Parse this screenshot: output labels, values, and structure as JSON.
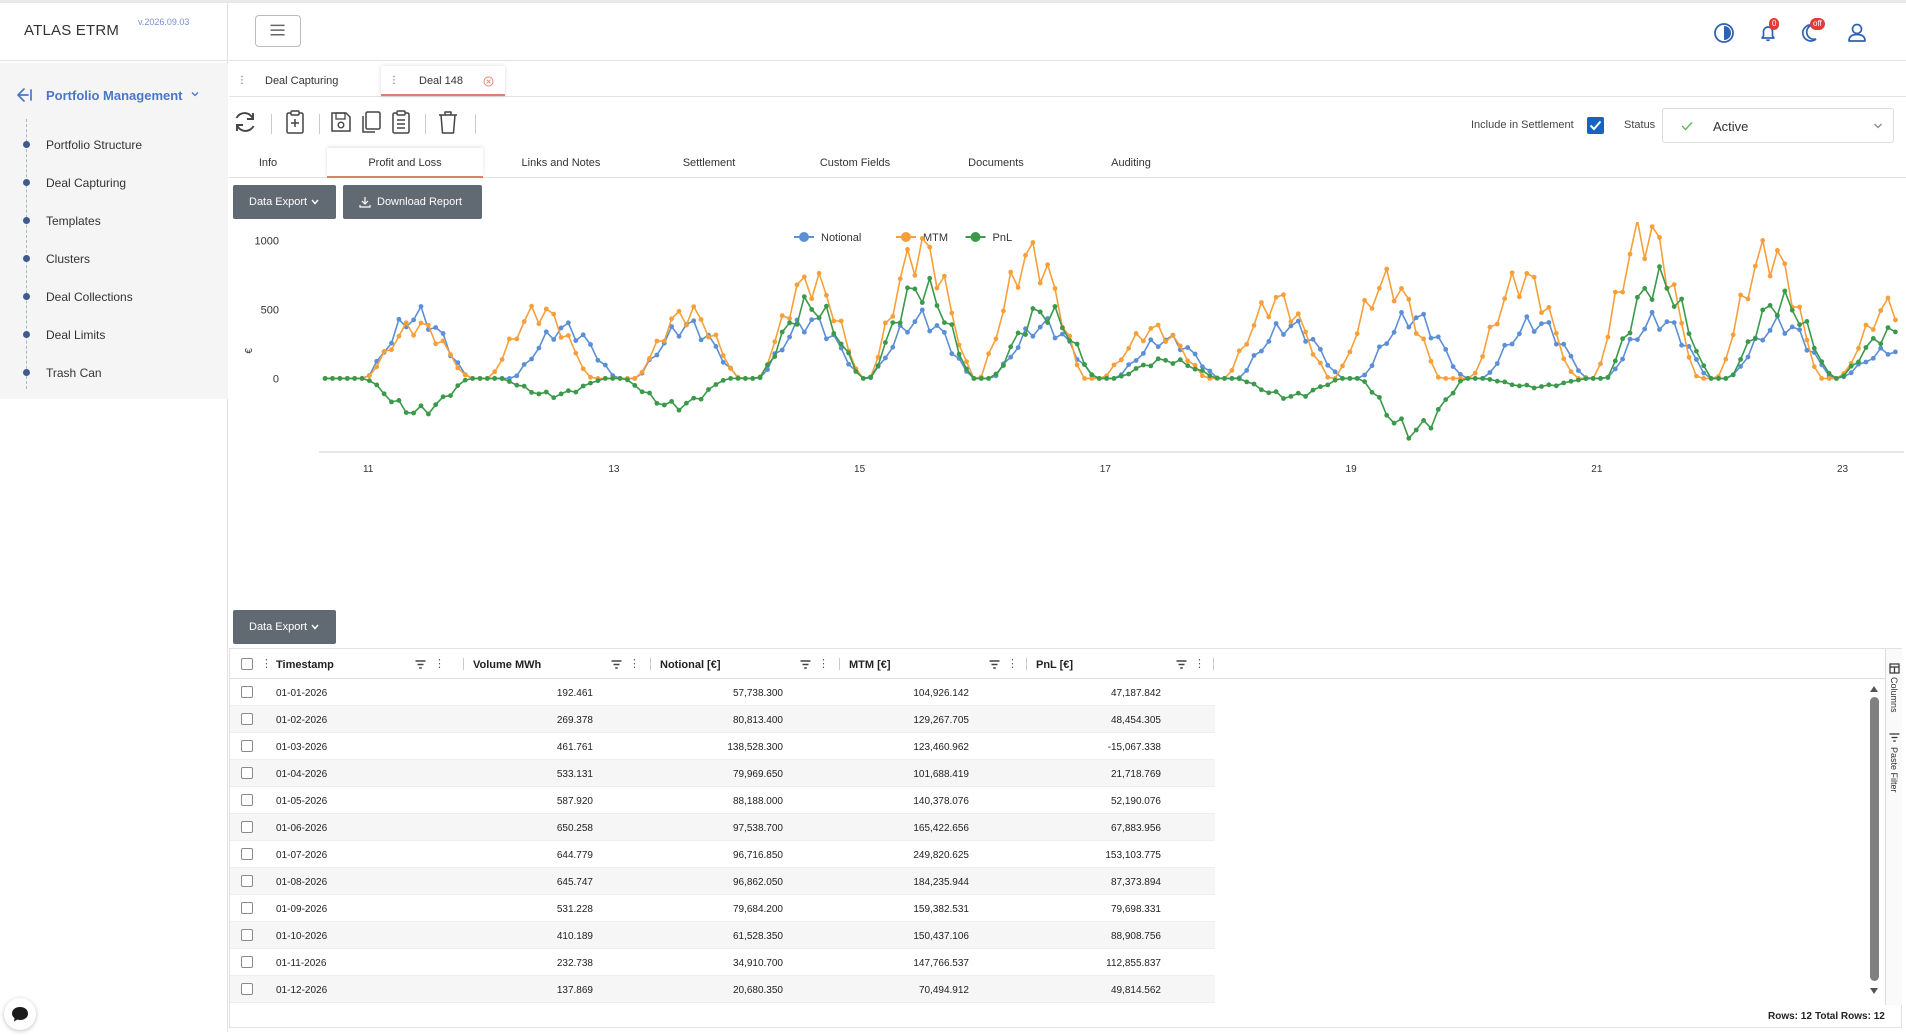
{
  "app": {
    "name": "ATLAS ETRM",
    "version": "v.2026.09.03"
  },
  "sidebar": {
    "section_title": "Portfolio Management",
    "items": [
      {
        "label": "Portfolio Structure"
      },
      {
        "label": "Deal Capturing"
      },
      {
        "label": "Templates"
      },
      {
        "label": "Clusters"
      },
      {
        "label": "Deal Collections"
      },
      {
        "label": "Deal Limits"
      },
      {
        "label": "Trash Can"
      }
    ]
  },
  "header": {
    "icons": [
      "theme-contrast-icon",
      "bell-icon",
      "moon-icon",
      "user-icon"
    ],
    "notifications_badge": "0",
    "dark_mode_badge": "off"
  },
  "doc_tabs": [
    {
      "label": "Deal Capturing"
    },
    {
      "label": "Deal 148"
    }
  ],
  "toolbar": {
    "icons": [
      "refresh-icon",
      "clipboard-add-icon",
      "save-icon",
      "copy-icon",
      "clipboard-list-icon",
      "trash-icon"
    ],
    "include_in_settlement_label": "Include in Settlement",
    "include_in_settlement_checked": true,
    "status_label": "Status",
    "status_value": "Active"
  },
  "sub_tabs": [
    {
      "label": "Info"
    },
    {
      "label": "Profit and Loss"
    },
    {
      "label": "Links and Notes"
    },
    {
      "label": "Settlement"
    },
    {
      "label": "Custom Fields"
    },
    {
      "label": "Documents"
    },
    {
      "label": "Auditing"
    }
  ],
  "buttons": {
    "data_export": "Data Export",
    "download_report": "Download Report",
    "data_export_2": "Data Export"
  },
  "chart_data": {
    "type": "line",
    "ylabel": "€",
    "yticks": [
      0,
      500,
      1000
    ],
    "xticks": [
      "11",
      "13",
      "15",
      "17",
      "19",
      "21",
      "23"
    ],
    "ylim": [
      -460,
      1060
    ],
    "xlim": [
      10.6,
      23.5
    ],
    "legend_position": "top",
    "series": [
      {
        "name": "Notional",
        "color": "#5b8fd6",
        "peaks": [
          [
            11.4,
            450
          ],
          [
            12.6,
            360
          ],
          [
            13.6,
            380
          ],
          [
            14.6,
            410
          ],
          [
            15.5,
            430
          ],
          [
            16.5,
            380
          ],
          [
            17.5,
            280
          ],
          [
            18.5,
            380
          ],
          [
            19.5,
            440
          ],
          [
            20.5,
            400
          ],
          [
            21.5,
            420
          ],
          [
            22.5,
            390
          ],
          [
            23.4,
            200
          ]
        ]
      },
      {
        "name": "MTM",
        "color": "#f7a03a",
        "peaks": [
          [
            11.4,
            380
          ],
          [
            12.4,
            480
          ],
          [
            13.6,
            470
          ],
          [
            14.6,
            700
          ],
          [
            15.5,
            930
          ],
          [
            16.4,
            880
          ],
          [
            17.4,
            350
          ],
          [
            18.4,
            560
          ],
          [
            19.3,
            690
          ],
          [
            20.4,
            720
          ],
          [
            21.4,
            1050
          ],
          [
            22.4,
            900
          ],
          [
            23.4,
            520
          ]
        ]
      },
      {
        "name": "PnL",
        "color": "#3a9a4a",
        "peaks": [
          [
            11.4,
            -240
          ],
          [
            12.5,
            -120
          ],
          [
            13.5,
            -200
          ],
          [
            14.6,
            520
          ],
          [
            15.5,
            650
          ],
          [
            16.5,
            480
          ],
          [
            17.5,
            130
          ],
          [
            18.5,
            -130
          ],
          [
            19.5,
            -380
          ],
          [
            20.5,
            -60
          ],
          [
            21.5,
            700
          ],
          [
            22.5,
            550
          ],
          [
            23.4,
            330
          ]
        ]
      }
    ]
  },
  "grid": {
    "columns": [
      "Timestamp",
      "Volume MWh",
      "Notional [€]",
      "MTM [€]",
      "PnL [€]"
    ],
    "rows": [
      [
        "01-01-2026",
        "192.461",
        "57,738.300",
        "104,926.142",
        "47,187.842"
      ],
      [
        "01-02-2026",
        "269.378",
        "80,813.400",
        "129,267.705",
        "48,454.305"
      ],
      [
        "01-03-2026",
        "461.761",
        "138,528.300",
        "123,460.962",
        "-15,067.338"
      ],
      [
        "01-04-2026",
        "533.131",
        "79,969.650",
        "101,688.419",
        "21,718.769"
      ],
      [
        "01-05-2026",
        "587.920",
        "88,188.000",
        "140,378.076",
        "52,190.076"
      ],
      [
        "01-06-2026",
        "650.258",
        "97,538.700",
        "165,422.656",
        "67,883.956"
      ],
      [
        "01-07-2026",
        "644.779",
        "96,716.850",
        "249,820.625",
        "153,103.775"
      ],
      [
        "01-08-2026",
        "645.747",
        "96,862.050",
        "184,235.944",
        "87,373.894"
      ],
      [
        "01-09-2026",
        "531.228",
        "79,684.200",
        "159,382.531",
        "79,698.331"
      ],
      [
        "01-10-2026",
        "410.189",
        "61,528.350",
        "150,437.106",
        "88,908.756"
      ],
      [
        "01-11-2026",
        "232.738",
        "34,910.700",
        "147,766.537",
        "112,855.837"
      ],
      [
        "01-12-2026",
        "137.869",
        "20,680.350",
        "70,494.912",
        "49,814.562"
      ]
    ],
    "side_panels": [
      "Columns",
      "Paste Filter"
    ],
    "footer": {
      "rows": "Rows: 12",
      "total_rows": "Total Rows: 12"
    }
  }
}
